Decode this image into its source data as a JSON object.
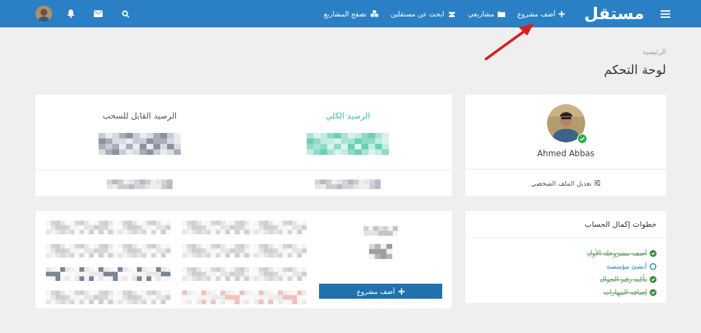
{
  "navbar": {
    "logo": "مستقل",
    "links": [
      {
        "label": "أضف مشروع",
        "kind": "plus"
      },
      {
        "label": "مشاريعي",
        "kind": "folder"
      },
      {
        "label": "ابحث عن مستقلين",
        "kind": "users"
      },
      {
        "label": "تصفح المشاريع",
        "kind": "cubes"
      }
    ]
  },
  "breadcrumb": "الرئيسية",
  "page_title": "لوحة التحكم",
  "profile": {
    "name": "Ahmed Abbas",
    "verified": true,
    "edit_link": "تعديل الملف الشخصي"
  },
  "balances": [
    {
      "label": "الرصيد الكلي",
      "color": "#3fbf9c"
    },
    {
      "label": "الرصيد القابل للسحب",
      "color": "#555555"
    }
  ],
  "projects_card": {
    "button": "أضف مشروع"
  },
  "account_steps": {
    "title": "خطوات إكمال الحساب",
    "items": [
      {
        "label": "أضف مشروعك الأول",
        "done": true
      },
      {
        "label": "أنشئ مؤسسة",
        "done": false
      },
      {
        "label": "تأكيد رقم الجوال",
        "done": true
      },
      {
        "label": "إضافة المهارات",
        "done": true
      }
    ]
  }
}
